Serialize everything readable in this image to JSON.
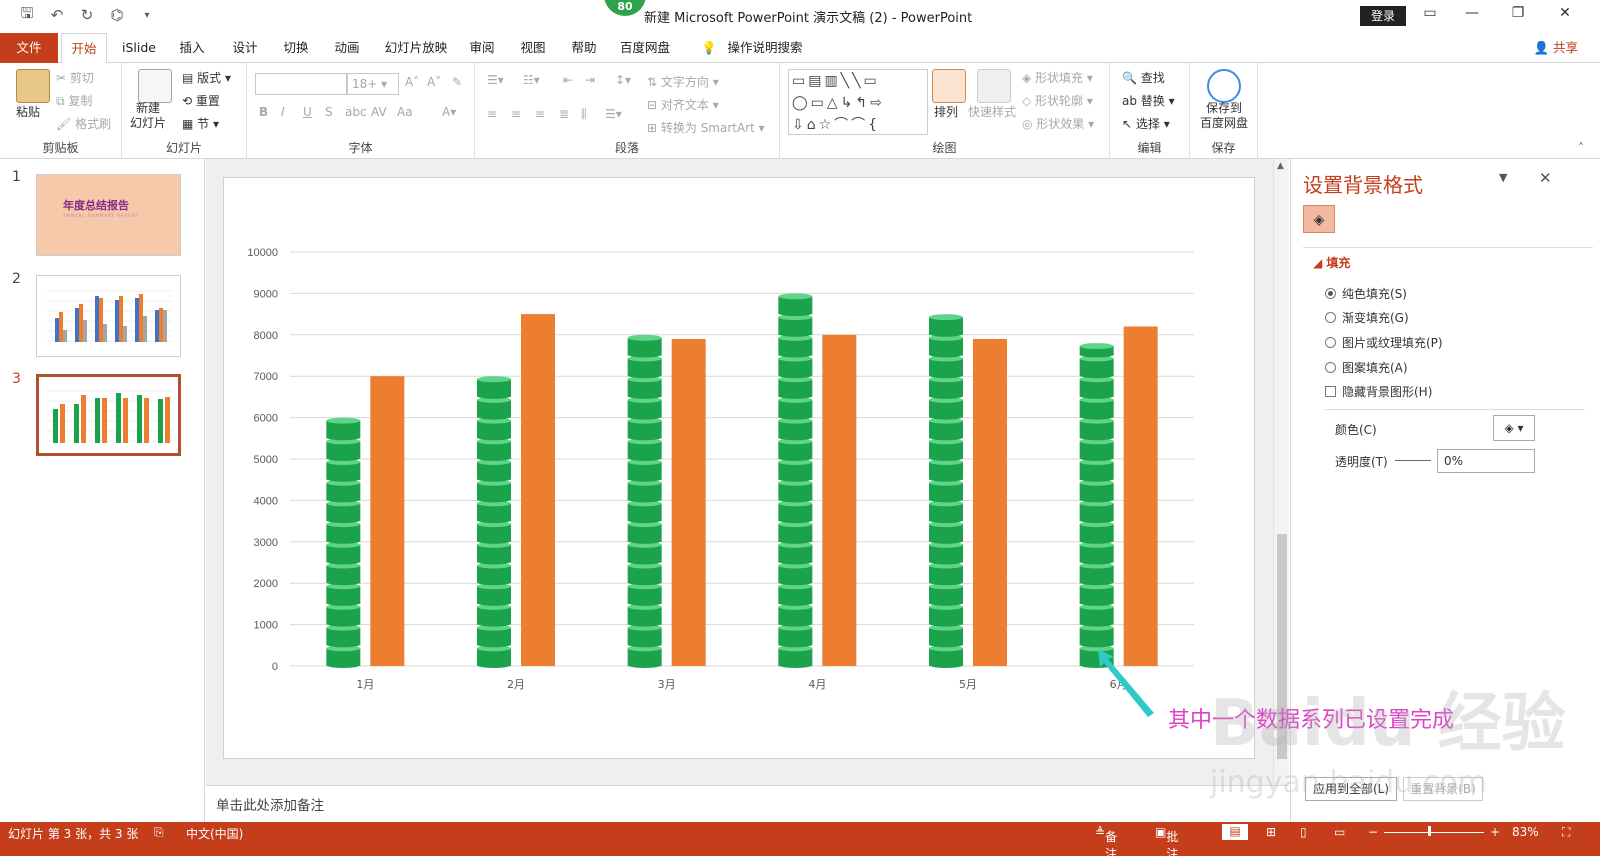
{
  "window": {
    "title": "新建 Microsoft PowerPoint 演示文稿 (2)  -  PowerPoint",
    "badge": "80",
    "login": "登录"
  },
  "tabs": [
    "文件",
    "开始",
    "iSlide",
    "插入",
    "设计",
    "切换",
    "动画",
    "幻灯片放映",
    "审阅",
    "视图",
    "帮助",
    "百度网盘",
    "操作说明搜索"
  ],
  "share": "共享",
  "ribbon": {
    "clipboard": {
      "paste": "粘贴",
      "cut": "剪切",
      "copy": "复制",
      "format_painter": "格式刷",
      "label": "剪贴板"
    },
    "slides": {
      "new_slide": "新建\n幻灯片",
      "layout": "版式",
      "reset": "重置",
      "section": "节",
      "label": "幻灯片"
    },
    "font": {
      "font_size": "18+",
      "label": "字体"
    },
    "paragraph": {
      "text_direction": "文字方向",
      "align_text": "对齐文本",
      "smartart": "转换为 SmartArt",
      "label": "段落"
    },
    "drawing": {
      "arrange": "排列",
      "quick_styles": "快速样式",
      "shape_fill": "形状填充",
      "shape_outline": "形状轮廓",
      "shape_effects": "形状效果",
      "label": "绘图"
    },
    "editing": {
      "find": "查找",
      "replace": "替换",
      "select": "选择",
      "label": "编辑"
    },
    "save": {
      "save_baidu": "保存到\n百度网盘",
      "label": "保存"
    }
  },
  "thumbnails": [
    {
      "number": "1",
      "title": "年度总结报告",
      "subtitle": "ANNUAL SUMMARY REPORT"
    },
    {
      "number": "2"
    },
    {
      "number": "3"
    }
  ],
  "chart_data": {
    "type": "bar",
    "categories": [
      "1月",
      "2月",
      "3月",
      "4月",
      "5月",
      "6月"
    ],
    "series": [
      {
        "values": [
          6000,
          7000,
          8000,
          9000,
          8500,
          7800
        ],
        "color": "#1aa34a",
        "style": "stacked-cylinders"
      },
      {
        "values": [
          7000,
          8500,
          7900,
          8000,
          7900,
          8200
        ],
        "color": "#ed7d31"
      }
    ],
    "yticks": [
      "0",
      "1000",
      "2000",
      "3000",
      "4000",
      "5000",
      "6000",
      "7000",
      "8000",
      "9000",
      "10000"
    ],
    "ylim": [
      0,
      10000
    ],
    "grid": true
  },
  "notes_placeholder": "单击此处添加备注",
  "format_pane": {
    "title": "设置背景格式",
    "section": "填充",
    "options": [
      "纯色填充(S)",
      "渐变填充(G)",
      "图片或纹理填充(P)",
      "图案填充(A)"
    ],
    "hide_bg": "隐藏背景图形(H)",
    "color_label": "颜色(C)",
    "transparency_label": "透明度(T)",
    "transparency_value": "0%",
    "apply_all": "应用到全部(L)",
    "reset_bg": "重置背景(B)"
  },
  "annotation": "其中一个数据系列已设置完成",
  "watermark": {
    "main": "Baidu 经验",
    "sub": "jingyan.baidu.com"
  },
  "status": {
    "slide_info": "幻灯片 第 3 张，共 3 张",
    "language": "中文(中国)",
    "notes": "备注",
    "comments": "批注",
    "zoom": "83%"
  }
}
